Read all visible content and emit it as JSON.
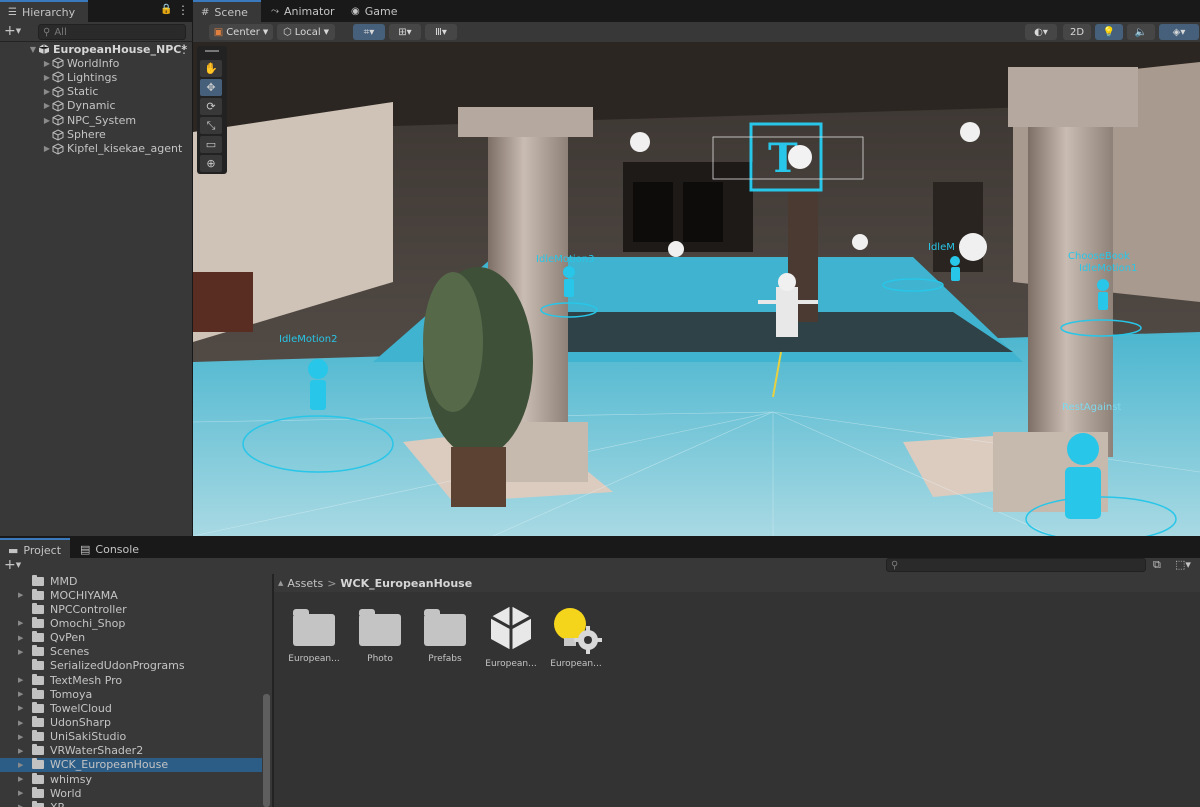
{
  "hierarchy": {
    "tab_label": "Hierarchy",
    "search_placeholder": "All",
    "scene_name": "EuropeanHouse_NPC*",
    "items": [
      {
        "label": "WorldInfo"
      },
      {
        "label": "Lightings"
      },
      {
        "label": "Static"
      },
      {
        "label": "Dynamic"
      },
      {
        "label": "NPC_System"
      },
      {
        "label": "Sphere"
      },
      {
        "label": "Kipfel_kisekae_agent"
      }
    ]
  },
  "scene_tabs": [
    {
      "label": "Scene",
      "icon": "grid-icon"
    },
    {
      "label": "Animator",
      "icon": "animator-icon"
    },
    {
      "label": "Game",
      "icon": "gamepad-icon"
    }
  ],
  "scene_toolbar": {
    "pivot_label": "Center",
    "space_label": "Local",
    "mode_2d_label": "2D"
  },
  "scene_labels": {
    "idle1": "IdleMotion1",
    "idle2": "IdleMotion2",
    "idle3": "IdleMotion3",
    "idle4": "IdleM",
    "choosebook": "ChooseBook",
    "restagainst": "RestAgainst"
  },
  "project": {
    "tab_label": "Project",
    "console_label": "Console",
    "folders": [
      {
        "label": "MMD",
        "expand": false
      },
      {
        "label": "MOCHIYAMA",
        "expand": true
      },
      {
        "label": "NPCController",
        "expand": false
      },
      {
        "label": "Omochi_Shop",
        "expand": true
      },
      {
        "label": "QvPen",
        "expand": true
      },
      {
        "label": "Scenes",
        "expand": true
      },
      {
        "label": "SerializedUdonPrograms",
        "expand": false
      },
      {
        "label": "TextMesh Pro",
        "expand": true
      },
      {
        "label": "Tomoya",
        "expand": true
      },
      {
        "label": "TowelCloud",
        "expand": true
      },
      {
        "label": "UdonSharp",
        "expand": true
      },
      {
        "label": "UniSakiStudio",
        "expand": true
      },
      {
        "label": "VRWaterShader2",
        "expand": true
      },
      {
        "label": "WCK_EuropeanHouse",
        "expand": true,
        "selected": true
      },
      {
        "label": "whimsy",
        "expand": true
      },
      {
        "label": "World",
        "expand": true
      },
      {
        "label": "XR",
        "expand": true
      }
    ],
    "breadcrumb_root": "Assets",
    "breadcrumb_current": "WCK_EuropeanHouse",
    "assets": [
      {
        "label": "European...",
        "type": "folder"
      },
      {
        "label": "Photo",
        "type": "folder"
      },
      {
        "label": "Prefabs",
        "type": "folder"
      },
      {
        "label": "European...",
        "type": "unity-scene"
      },
      {
        "label": "European...",
        "type": "lighting-settings"
      }
    ]
  },
  "colors": {
    "accent_blue": "#3a79bb",
    "selection": "#2c5d87",
    "gizmo_cyan": "#28c6e8"
  }
}
